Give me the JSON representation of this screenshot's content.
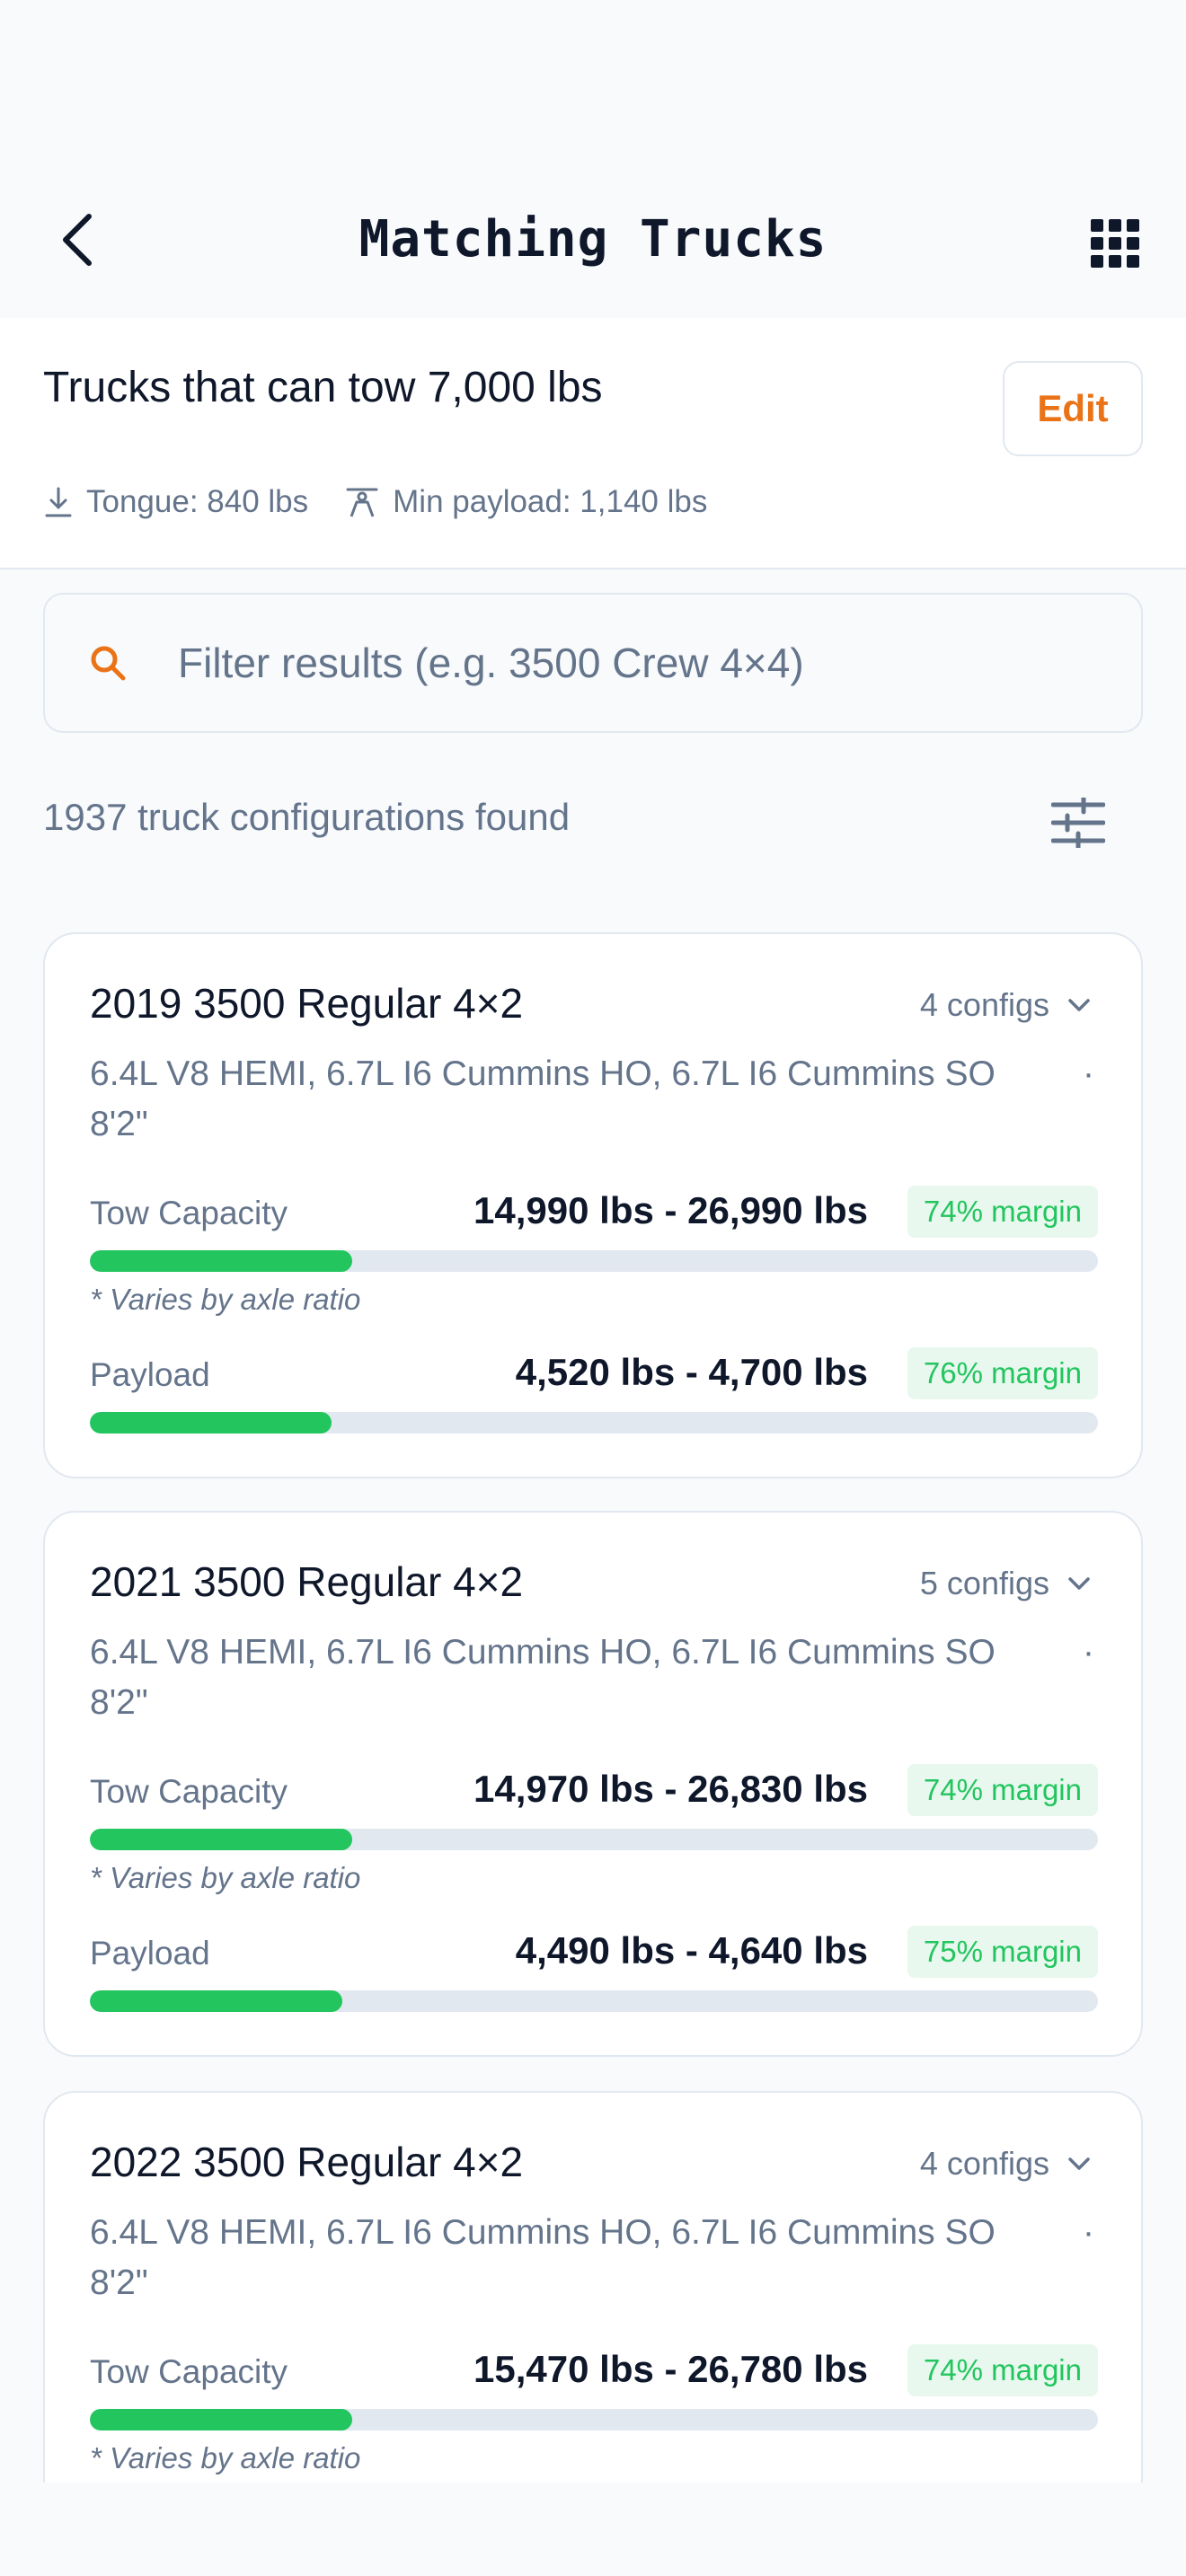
{
  "nav": {
    "title": "Matching Trucks",
    "back_icon": "chevron-left-icon",
    "menu_icon": "grid-icon"
  },
  "header": {
    "title": "Trucks that can tow 7,000 lbs",
    "edit_label": "Edit",
    "tongue": "Tongue: 840 lbs",
    "min_payload": "Min payload: 1,140 lbs"
  },
  "search": {
    "placeholder": "Filter results (e.g. 3500 Crew 4×4)"
  },
  "results": {
    "count_text": "1937 truck configurations found"
  },
  "colors": {
    "accent": "#ea7317",
    "success": "#22c55e",
    "success_bg": "#e8f8ee",
    "muted": "#64748b",
    "border": "#e2e8f0"
  },
  "cards": [
    {
      "title": "2019 3500 Regular 4×2",
      "configs": "4 configs",
      "engines": "6.4L V8 HEMI, 6.7L I6 Cummins HO, 6.7L I6 Cummins SO",
      "dot": "·",
      "bed": "8'2\"",
      "tow_label": "Tow Capacity",
      "tow_value": "14,990 lbs - 26,990 lbs",
      "tow_margin": "74% margin",
      "tow_fill": 0.26,
      "note": "* Varies by axle ratio",
      "payload_label": "Payload",
      "payload_value": "4,520 lbs - 4,700 lbs",
      "payload_margin": "76% margin",
      "payload_fill": 0.24
    },
    {
      "title": "2021 3500 Regular 4×2",
      "configs": "5 configs",
      "engines": "6.4L V8 HEMI, 6.7L I6 Cummins HO, 6.7L I6 Cummins SO",
      "dot": "·",
      "bed": "8'2\"",
      "tow_label": "Tow Capacity",
      "tow_value": "14,970 lbs - 26,830 lbs",
      "tow_margin": "74% margin",
      "tow_fill": 0.26,
      "note": "* Varies by axle ratio",
      "payload_label": "Payload",
      "payload_value": "4,490 lbs - 4,640 lbs",
      "payload_margin": "75% margin",
      "payload_fill": 0.25
    },
    {
      "title": "2022 3500 Regular 4×2",
      "configs": "4 configs",
      "engines": "6.4L V8 HEMI, 6.7L I6 Cummins HO, 6.7L I6 Cummins SO",
      "dot": "·",
      "bed": "8'2\"",
      "tow_label": "Tow Capacity",
      "tow_value": "15,470 lbs - 26,780 lbs",
      "tow_margin": "74% margin",
      "tow_fill": 0.26,
      "note": "* Varies by axle ratio"
    }
  ]
}
